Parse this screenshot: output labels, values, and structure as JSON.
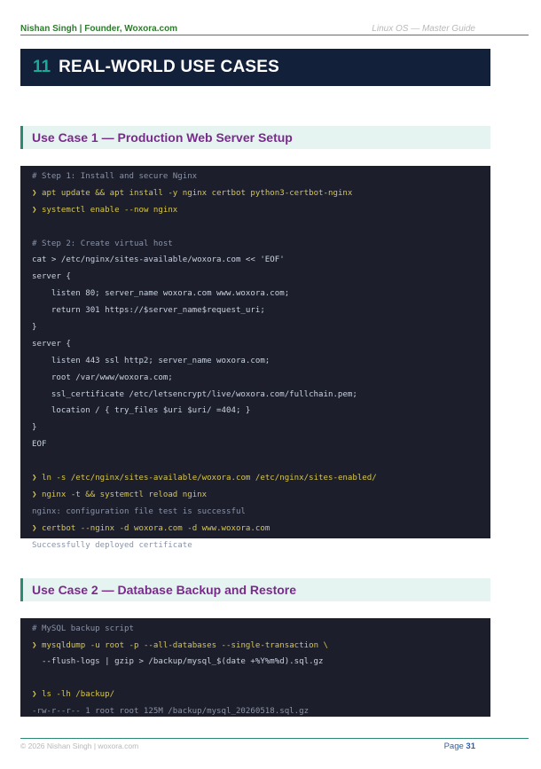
{
  "header": {
    "left": "Nishan Singh  |  Founder, Woxora.com",
    "right": "Linux OS — Master Guide"
  },
  "section": {
    "number": "11",
    "title": "REAL-WORLD USE CASES"
  },
  "usecase1": {
    "title": "Use Case 1 — Production Web Server Setup",
    "lines": [
      {
        "kind": "comment",
        "text": "# Step 1: Install and secure Nginx"
      },
      {
        "kind": "cmd",
        "text": "apt update && apt install -y nginx certbot python3-certbot-nginx"
      },
      {
        "kind": "cmd",
        "text": "systemctl enable --now nginx"
      },
      {
        "kind": "blank",
        "text": ""
      },
      {
        "kind": "comment",
        "text": "# Step 2: Create virtual host"
      },
      {
        "kind": "text",
        "text": "cat > /etc/nginx/sites-available/woxora.com << 'EOF'"
      },
      {
        "kind": "text",
        "text": "server {"
      },
      {
        "kind": "text",
        "text": "    listen 80; server_name woxora.com www.woxora.com;"
      },
      {
        "kind": "text",
        "text": "    return 301 https://$server_name$request_uri;"
      },
      {
        "kind": "text",
        "text": "}"
      },
      {
        "kind": "text",
        "text": "server {"
      },
      {
        "kind": "text",
        "text": "    listen 443 ssl http2; server_name woxora.com;"
      },
      {
        "kind": "text",
        "text": "    root /var/www/woxora.com;"
      },
      {
        "kind": "text",
        "text": "    ssl_certificate /etc/letsencrypt/live/woxora.com/fullchain.pem;"
      },
      {
        "kind": "text",
        "text": "    location / { try_files $uri $uri/ =404; }"
      },
      {
        "kind": "text",
        "text": "}"
      },
      {
        "kind": "text",
        "text": "EOF"
      },
      {
        "kind": "blank",
        "text": ""
      },
      {
        "kind": "cmd",
        "text": "ln -s /etc/nginx/sites-available/woxora.com /etc/nginx/sites-enabled/"
      },
      {
        "kind": "cmd",
        "text": "nginx -t && systemctl reload nginx"
      },
      {
        "kind": "output",
        "text": "nginx: configuration file test is successful"
      },
      {
        "kind": "cmd",
        "text": "certbot --nginx -d woxora.com -d www.woxora.com"
      },
      {
        "kind": "output",
        "text": "Successfully deployed certificate"
      }
    ]
  },
  "usecase2": {
    "title": "Use Case 2 — Database Backup and Restore",
    "lines": [
      {
        "kind": "comment",
        "text": "# MySQL backup script"
      },
      {
        "kind": "cmd",
        "text": "mysqldump -u root -p --all-databases --single-transaction \\"
      },
      {
        "kind": "text",
        "text": "  --flush-logs | gzip > /backup/mysql_$(date +%Y%m%d).sql.gz"
      },
      {
        "kind": "blank",
        "text": ""
      },
      {
        "kind": "cmd",
        "text": "ls -lh /backup/"
      },
      {
        "kind": "output",
        "text": "-rw-r--r-- 1 root root 125M /backup/mysql_20260518.sql.gz"
      }
    ]
  },
  "prompt_glyph": "❯",
  "footer": {
    "left": "© 2026 Nishan Singh | woxora.com",
    "page_label": "Page",
    "page_number": "31"
  },
  "colors": {
    "banner": "#13203a",
    "accent": "#1aa99a",
    "heading": "#7a2a8c",
    "code_bg": "#1c1e2b",
    "command": "#d7c74a"
  }
}
